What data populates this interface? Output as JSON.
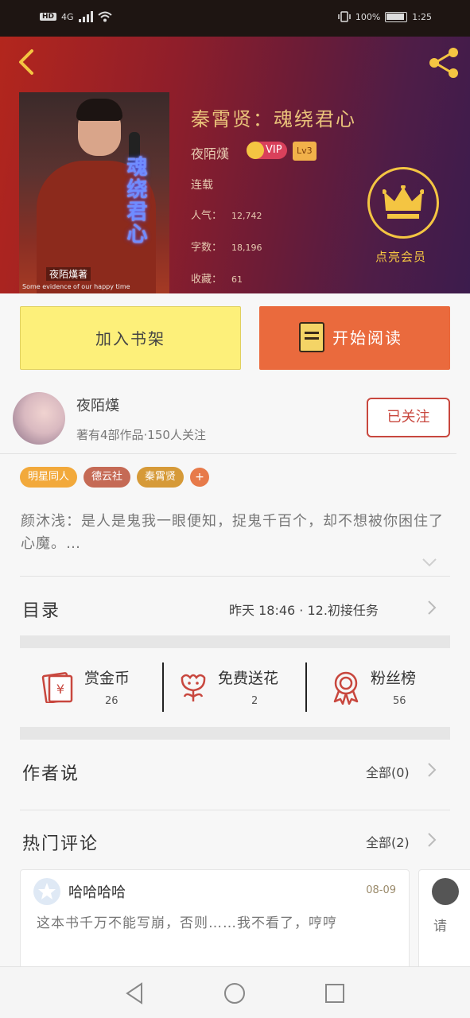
{
  "status_bar": {
    "network": "HD",
    "signal": "4G",
    "battery_pct": "100%",
    "time": "1:25"
  },
  "hero": {
    "book_title": "秦霄贤：魂绕君心",
    "author": "夜陌熯",
    "vip_label": "VIP",
    "level_label": "Lv3",
    "status": "连载",
    "stats": [
      {
        "label": "人气：",
        "value": "12,742"
      },
      {
        "label": "字数：",
        "value": "18,196"
      },
      {
        "label": "收藏：",
        "value": "61"
      }
    ],
    "cover_vertical_title": "魂绕君心",
    "cover_author": "夜陌熯著",
    "cover_caption": "Some evidence of our happy time",
    "vip_action_label": "点亮会员"
  },
  "actions": {
    "add_shelf": "加入书架",
    "start_read": "开始阅读"
  },
  "author_row": {
    "name": "夜陌熯",
    "meta": "著有4部作品·150人关注",
    "follow_label": "已关注"
  },
  "tags": [
    {
      "label": "明星同人",
      "color": "#f2a93b"
    },
    {
      "label": "德云社",
      "color": "#c56a55"
    },
    {
      "label": "秦霄贤",
      "color": "#d69a38"
    }
  ],
  "tag_more": "+",
  "synopsis": "颜沐浅：是人是鬼我一眼便知，捉鬼千百个，却不想被你困住了心魔。…",
  "toc": {
    "label": "目录",
    "latest": "昨天 18:46 · 12.初接任务"
  },
  "rewards": [
    {
      "title": "赏金币",
      "count": "26",
      "icon": "red-envelope-icon"
    },
    {
      "title": "免费送花",
      "count": "2",
      "icon": "flower-icon"
    },
    {
      "title": "粉丝榜",
      "count": "56",
      "icon": "medal-icon"
    }
  ],
  "author_says": {
    "label": "作者说",
    "link": "全部(0)"
  },
  "hot_comments": {
    "label": "热门评论",
    "link": "全部(2)",
    "items": [
      {
        "name": "哈哈哈哈",
        "date": "08-09",
        "text": "这本书千万不能写崩，否则……我不看了，哼哼"
      },
      {
        "name": "",
        "date": "",
        "text": "请"
      }
    ]
  },
  "colors": {
    "accent": "#ea6a3d",
    "shelf_button": "#fdf07a",
    "follow": "#c8473e",
    "gold": "#f4c542"
  }
}
